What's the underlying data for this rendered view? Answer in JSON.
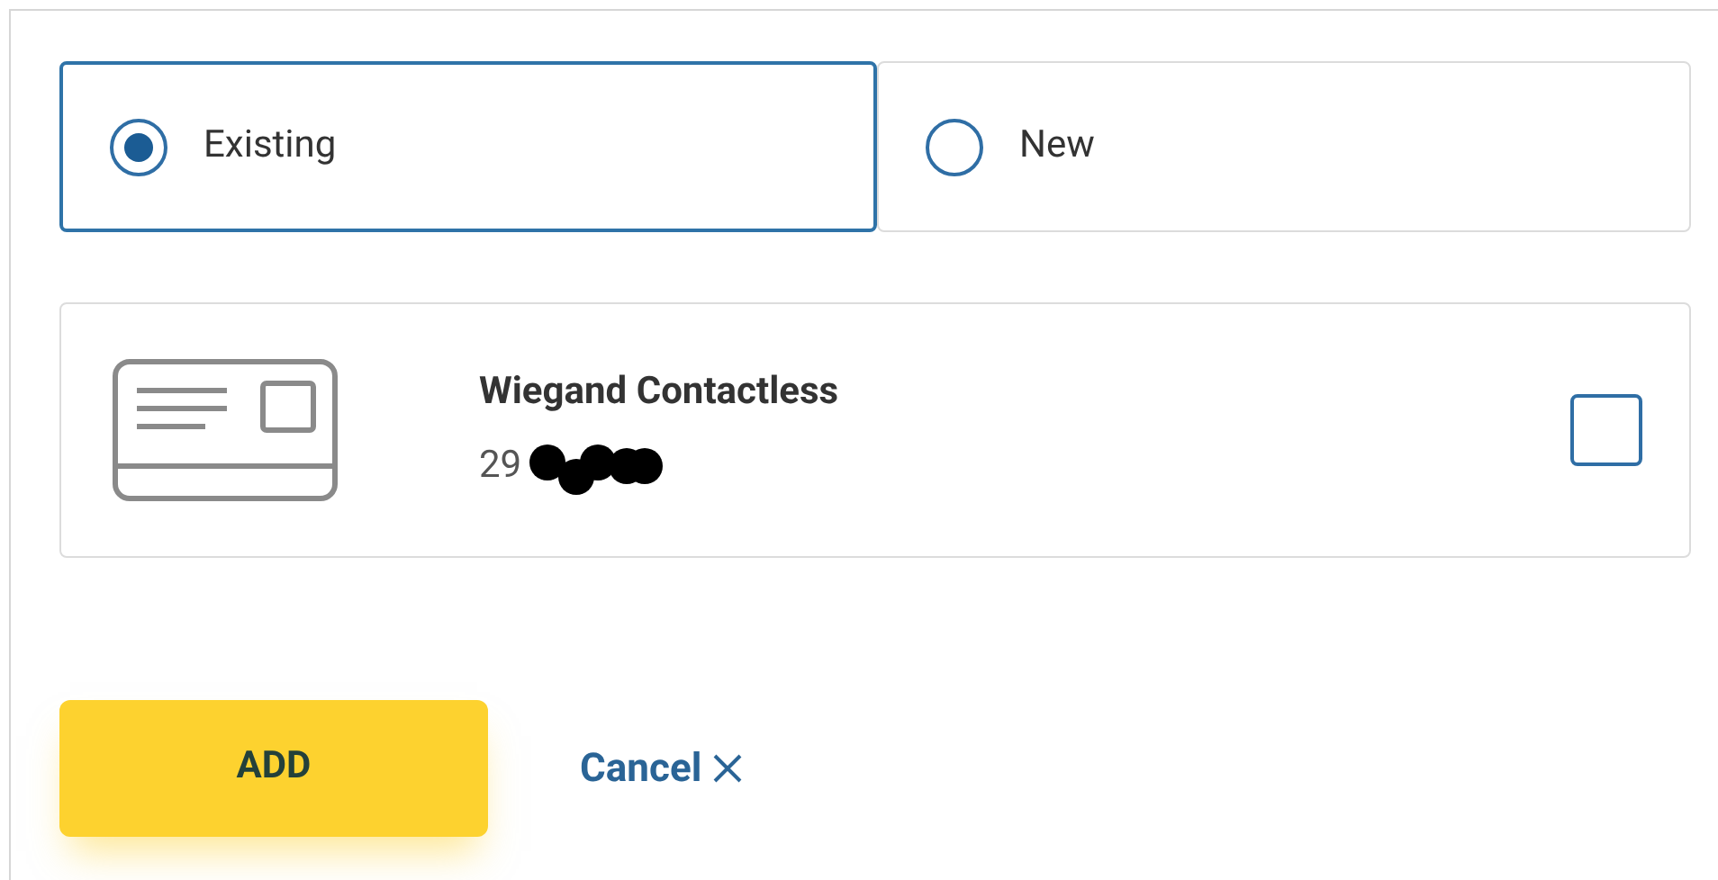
{
  "options": [
    {
      "label": "Existing",
      "selected": true
    },
    {
      "label": "New",
      "selected": false
    }
  ],
  "credential": {
    "title": "Wiegand Contactless",
    "number": "29",
    "checked": false
  },
  "buttons": {
    "add": "ADD",
    "cancel": "Cancel"
  }
}
